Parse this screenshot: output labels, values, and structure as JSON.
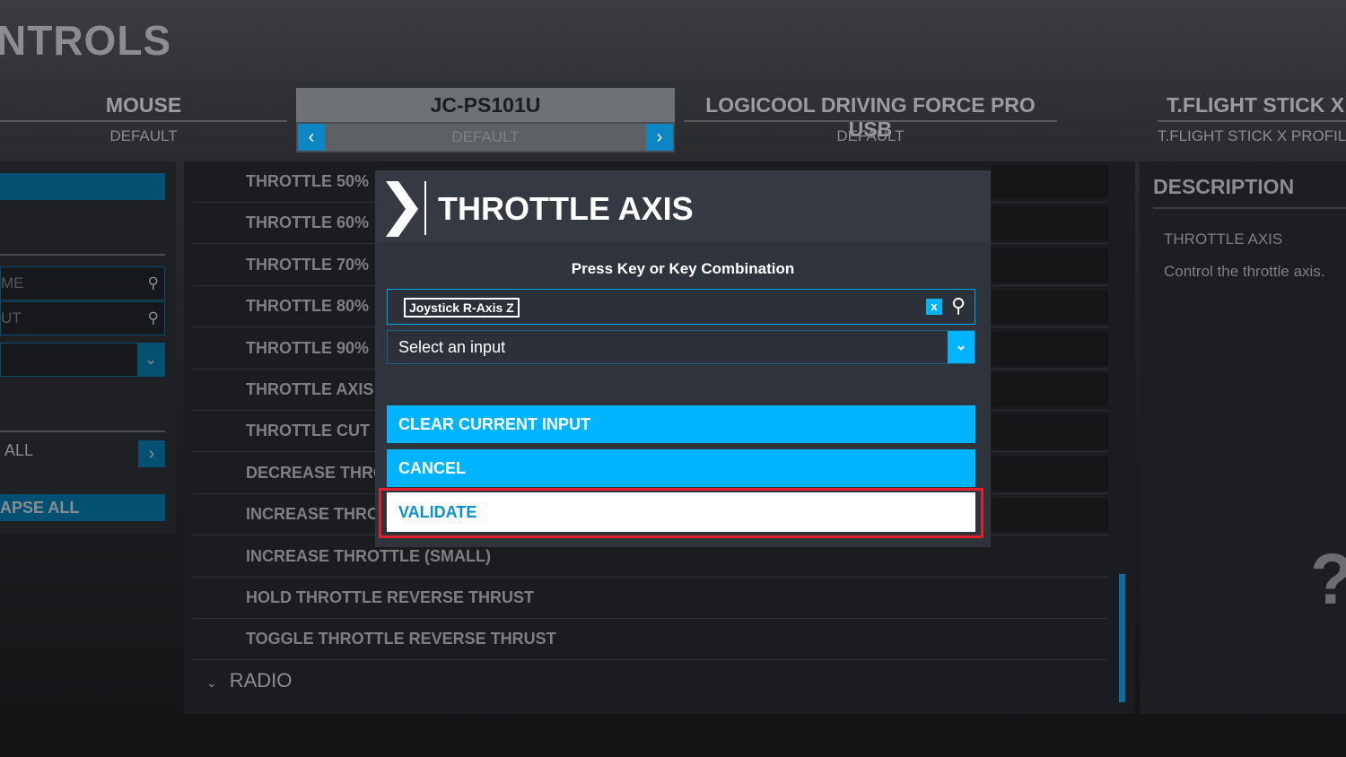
{
  "header": {
    "title": "NTROLS"
  },
  "devices": [
    {
      "name": "MOUSE",
      "profile": "DEFAULT"
    },
    {
      "name": "JC-PS101U",
      "profile": "DEFAULT",
      "active": true
    },
    {
      "name": "LOGICOOL DRIVING FORCE PRO USB",
      "profile": "DEFAULT"
    },
    {
      "name": "T.FLIGHT STICK X",
      "profile": "T.FLIGHT STICK X PROFIL"
    }
  ],
  "sidebar": {
    "search_name_placeholder": "ME",
    "search_input_placeholder": "UT",
    "expand_all": "ALL",
    "collapse_all": "APSE ALL"
  },
  "list": {
    "items": [
      "THROTTLE 50%",
      "THROTTLE 60%",
      "THROTTLE 70%",
      "THROTTLE 80%",
      "THROTTLE 90%",
      "THROTTLE AXIS",
      "THROTTLE CUT",
      "DECREASE THRO",
      "INCREASE THRO",
      "INCREASE THROTTLE (SMALL)",
      "HOLD THROTTLE REVERSE THRUST",
      "TOGGLE THROTTLE REVERSE THRUST"
    ],
    "category": "RADIO"
  },
  "description": {
    "heading": "DESCRIPTION",
    "name": "THROTTLE AXIS",
    "text": "Control the throttle axis."
  },
  "modal": {
    "title": "THROTTLE AXIS",
    "prompt": "Press Key or Key Combination",
    "current_input": "Joystick R-Axis Z",
    "clear_x": "x",
    "select_placeholder": "Select an input",
    "clear_button": "CLEAR CURRENT INPUT",
    "cancel_button": "CANCEL",
    "validate_button": "VALIDATE"
  },
  "colors": {
    "accent": "#00b4ff",
    "highlight": "#e0202a"
  }
}
